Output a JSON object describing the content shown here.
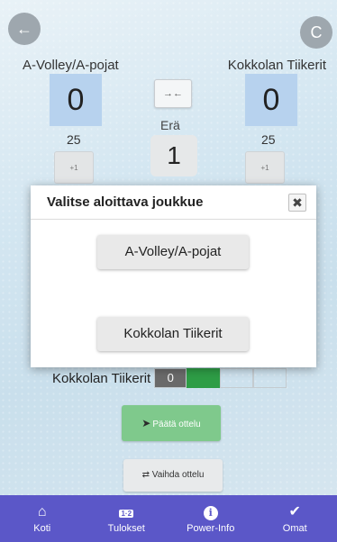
{
  "header": {
    "back_icon": "arrow-left-icon",
    "refresh_icon": "refresh-icon",
    "back_glyph": "←",
    "refresh_glyph": "C"
  },
  "match": {
    "team_a": "A-Volley/A-pojat",
    "team_b": "Kokkolan Tiikerit",
    "score_a": "0",
    "score_b": "0",
    "target_a": "25",
    "target_b": "25",
    "set_label": "Erä",
    "set_number": "1",
    "plus_a": "+1",
    "plus_b": "+1",
    "swap_glyph": "→←"
  },
  "modal": {
    "title": "Valitse aloittava joukkue",
    "close_glyph": "✖",
    "choice_a": "A-Volley/A-pojat",
    "choice_b": "Kokkolan Tiikerit"
  },
  "set_table": {
    "team": "Kokkolan Tiikerit",
    "score": "0"
  },
  "actions": {
    "end_match": "Päätä ottelu",
    "end_glyph": "➤",
    "change_match": "Vaihda ottelu",
    "change_glyph": "⇄"
  },
  "nav": {
    "items": [
      {
        "label": "Koti",
        "icon": "home-icon",
        "glyph": "⌂"
      },
      {
        "label": "Tulokset",
        "icon": "scoreboard-icon",
        "glyph": "1·2"
      },
      {
        "label": "Power-Info",
        "icon": "info-icon",
        "glyph": "i"
      },
      {
        "label": "Omat",
        "icon": "shield-check-icon",
        "glyph": "✔"
      }
    ]
  },
  "colors": {
    "nav_bg": "#5b57c8",
    "score_bg": "#b7d2ee",
    "end_button": "#7fc98c",
    "set_green": "#2e9d46"
  }
}
